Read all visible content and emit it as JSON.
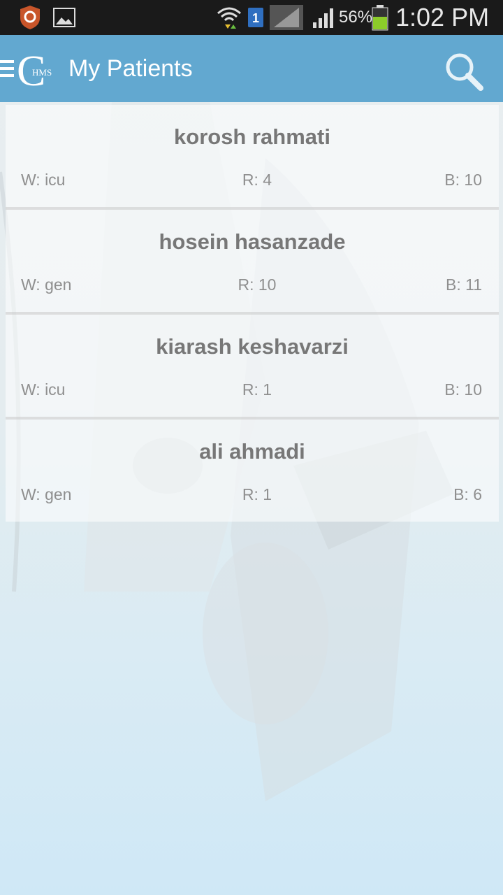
{
  "status_bar": {
    "battery_percent": "56%",
    "time": "1:02 PM",
    "sim_label": "1",
    "icons": [
      "app-notification-icon",
      "gallery-icon",
      "wifi-icon",
      "sim-icon",
      "signal-icon",
      "battery-icon"
    ]
  },
  "app_bar": {
    "logo_letter": "C",
    "logo_text": "HMS",
    "title": "My Patients",
    "background": "#62a8d0"
  },
  "patients": [
    {
      "name": "korosh rahmati",
      "ward": "W: icu",
      "room": "R: 4",
      "bed": "B: 10"
    },
    {
      "name": "hosein hasanzade",
      "ward": "W: gen",
      "room": "R: 10",
      "bed": "B: 11"
    },
    {
      "name": "kiarash keshavarzi",
      "ward": "W: icu",
      "room": "R: 1",
      "bed": "B: 10"
    },
    {
      "name": "ali ahmadi",
      "ward": "W: gen",
      "room": "R: 1",
      "bed": "B: 6"
    }
  ]
}
